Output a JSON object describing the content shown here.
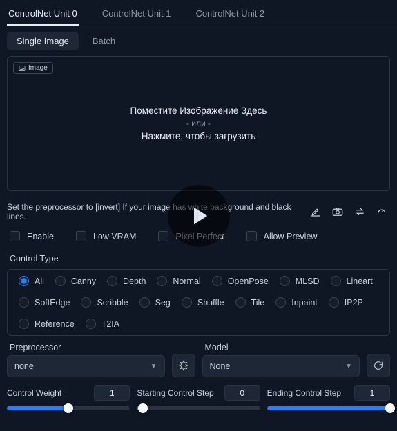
{
  "tabs_main": [
    "ControlNet Unit 0",
    "ControlNet Unit 1",
    "ControlNet Unit 2"
  ],
  "tabs_main_active": 0,
  "tabs_sub": [
    "Single Image",
    "Batch"
  ],
  "tabs_sub_active": 0,
  "dropzone": {
    "badge": "Image",
    "line1": "Поместите Изображение Здесь",
    "or": "- или -",
    "line2": "Нажмите, чтобы загрузить"
  },
  "hint": "Set the preprocessor to [invert] If your image has white background and black lines.",
  "checks": [
    "Enable",
    "Low VRAM",
    "Pixel Perfect",
    "Allow Preview"
  ],
  "control_type_label": "Control Type",
  "control_types": [
    "All",
    "Canny",
    "Depth",
    "Normal",
    "OpenPose",
    "MLSD",
    "Lineart",
    "SoftEdge",
    "Scribble",
    "Seg",
    "Shuffle",
    "Tile",
    "Inpaint",
    "IP2P",
    "Reference",
    "T2IA"
  ],
  "control_type_selected": 0,
  "preprocessor": {
    "label": "Preprocessor",
    "value": "none"
  },
  "model": {
    "label": "Model",
    "value": "None"
  },
  "sliders": {
    "weight": {
      "label": "Control Weight",
      "value": 1,
      "fill": 50
    },
    "start": {
      "label": "Starting Control Step",
      "value": 0,
      "fill": 5
    },
    "end": {
      "label": "Ending Control Step",
      "value": 1,
      "fill": 100
    }
  }
}
